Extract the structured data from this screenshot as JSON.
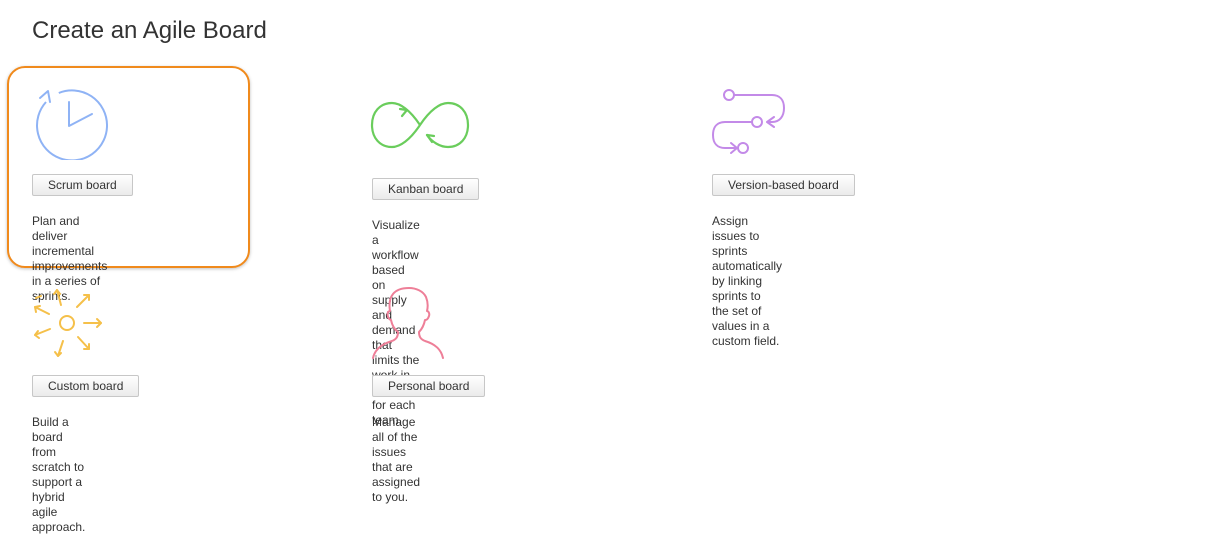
{
  "page": {
    "title": "Create an Agile Board"
  },
  "boards": {
    "scrum": {
      "button": "Scrum board",
      "description": "Plan and deliver incremental\nimprovements in a series of sprints.",
      "icon": "clock-icon",
      "color": "#8fb3f5"
    },
    "kanban": {
      "button": "Kanban board",
      "description": "Visualize a workflow based on\nsupply and demand that limits the\nwork in progress for each team.",
      "icon": "infinity-loop-icon",
      "color": "#6acd5c"
    },
    "version": {
      "button": "Version-based board",
      "description": "Assign issues to sprints\nautomatically by linking sprints to\nthe set of values in a custom field.",
      "icon": "version-flow-icon",
      "color": "#c38ae8"
    },
    "custom": {
      "button": "Custom board",
      "description": "Build a board from scratch to\nsupport a hybrid agile approach.",
      "icon": "sun-arrows-icon",
      "color": "#f5c04a"
    },
    "personal": {
      "button": "Personal board",
      "description": "Manage all of the issues that are\nassigned to you.",
      "icon": "person-silhouette-icon",
      "color": "#ee7f98"
    }
  },
  "highlight_color": "#f08a1c"
}
